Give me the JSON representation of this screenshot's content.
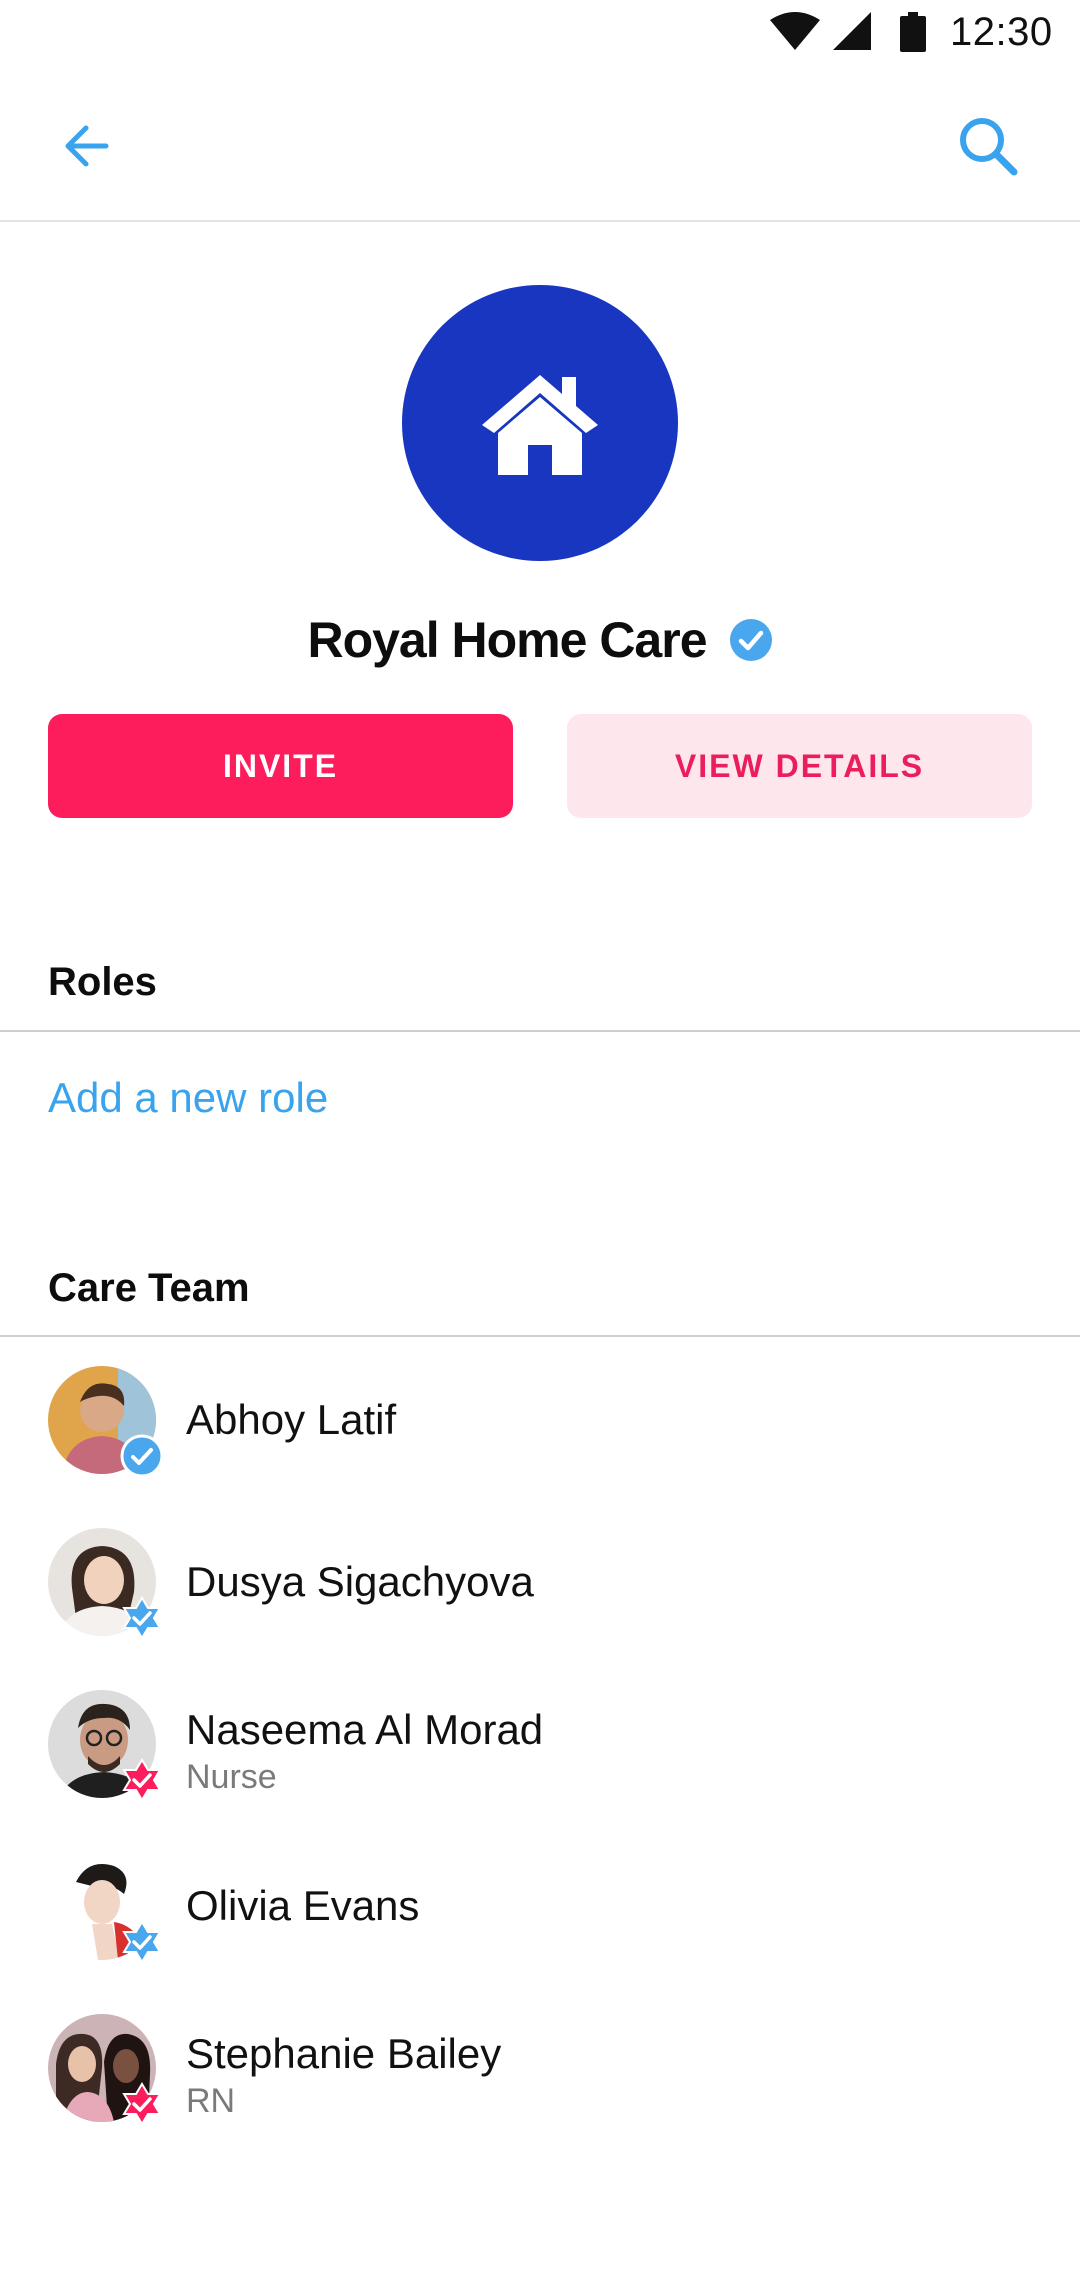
{
  "status_bar": {
    "time": "12:30"
  },
  "app_bar": {
    "back_icon": "arrow-left-icon",
    "search_icon": "search-icon"
  },
  "profile": {
    "icon": "home-icon",
    "name": "Royal Home Care",
    "verified_icon": "verified-check-icon",
    "accent_color": "#1836bf"
  },
  "actions": {
    "invite_label": "INVITE",
    "details_label": "VIEW DETAILS"
  },
  "roles": {
    "title": "Roles",
    "add_role_label": "Add a new role"
  },
  "care_team": {
    "title": "Care Team",
    "members": [
      {
        "name": "Abhoy Latif",
        "role": "",
        "badge": "verified-check-icon"
      },
      {
        "name": "Dusya Sigachyova",
        "role": "",
        "badge": "blue-star-check-icon"
      },
      {
        "name": "Naseema Al Morad",
        "role": "Nurse",
        "badge": "red-star-check-icon"
      },
      {
        "name": "Olivia Evans",
        "role": "",
        "badge": "blue-star-check-icon"
      },
      {
        "name": "Stephanie Bailey",
        "role": "RN",
        "badge": "red-star-check-icon"
      }
    ]
  },
  "colors": {
    "primary": "#fd1d5d",
    "link": "#3aa3ee",
    "verified": "#4aa7ee"
  }
}
